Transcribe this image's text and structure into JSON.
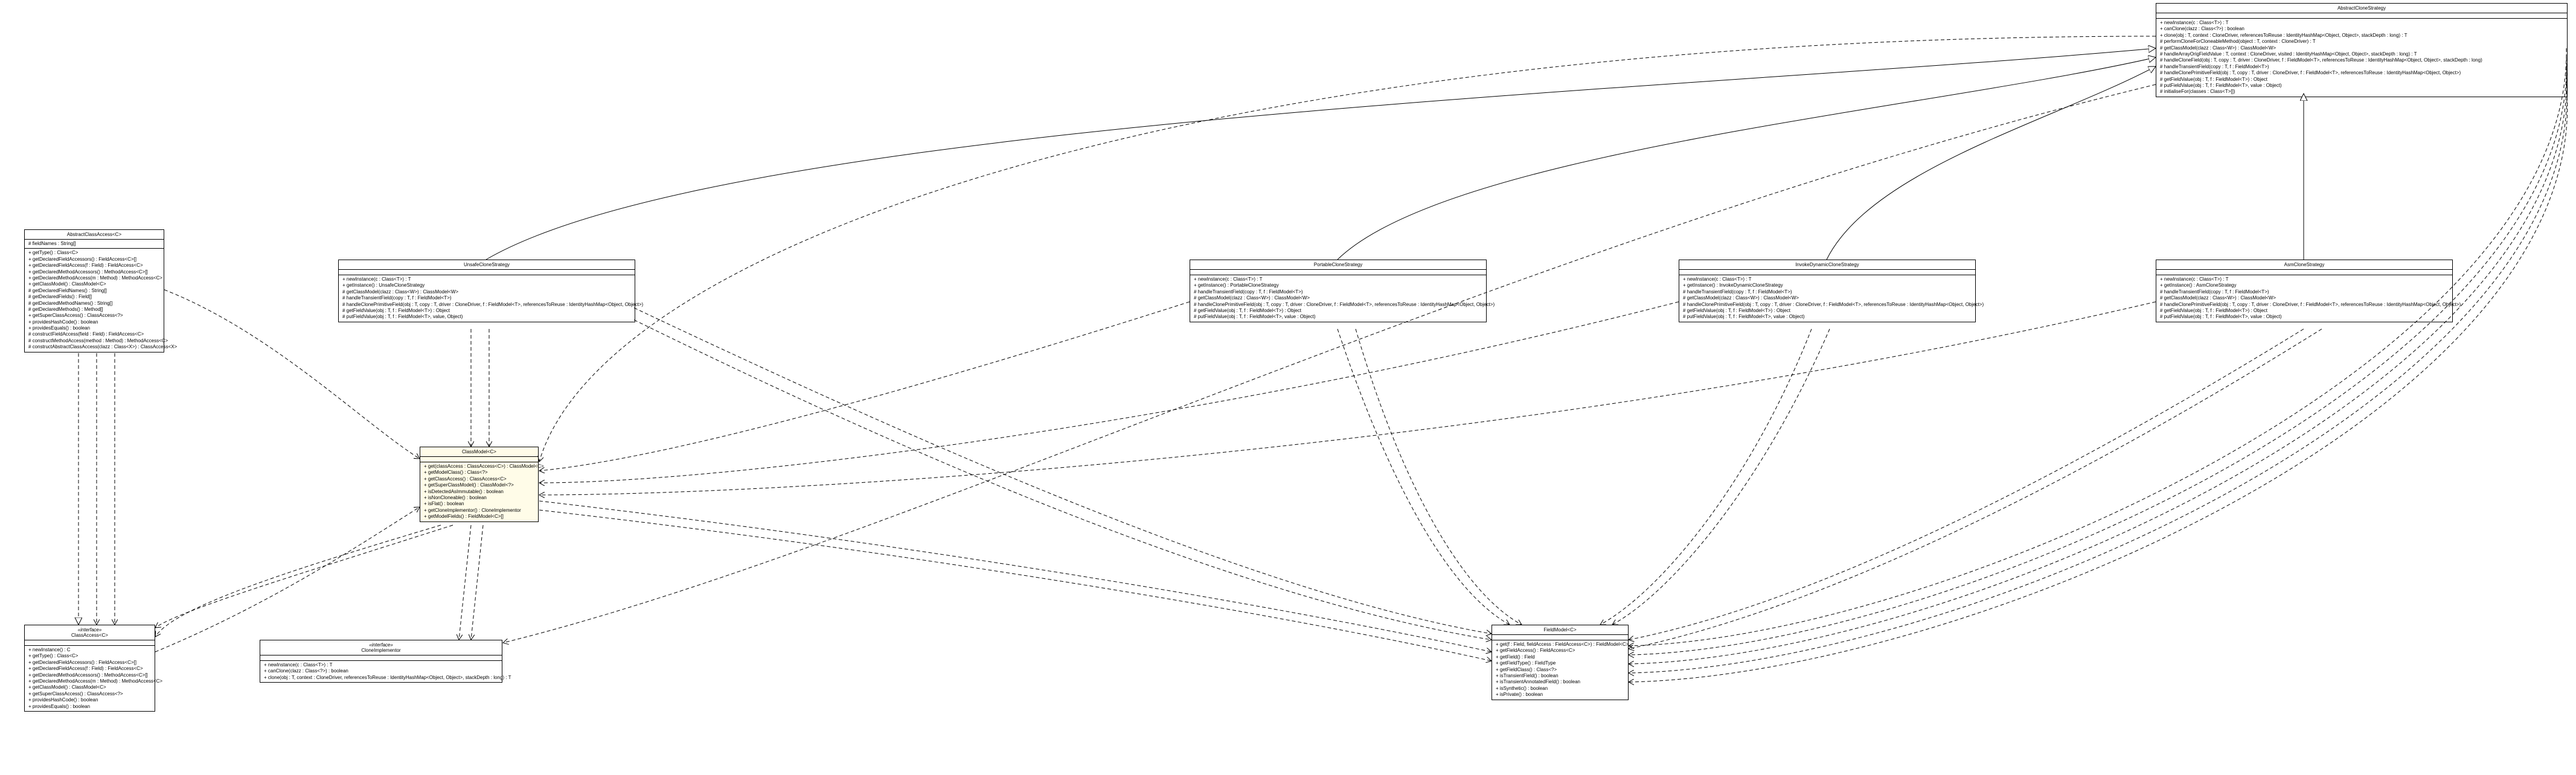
{
  "classes": {
    "abstractCloneStrategy": {
      "title": "AbstractCloneStrategy",
      "methods": [
        "+ newInstance(c : Class<T>) : T",
        "+ canClone(clazz : Class<?>) : boolean",
        "+ clone(obj : T, context : CloneDriver, referencesToReuse : IdentityHashMap<Object, Object>, stackDepth : long) : T",
        "# performCloneForCloneableMethod(object : T, context : CloneDriver) : T",
        "# getClassModel(clazz : Class<W>) : ClassModel<W>",
        "# handleArrayOrigFieldValue : T, context : CloneDriver, visited : IdentityHashMap<Object, Object>, stackDepth : long) : T",
        "# handleCloneField(obj : T, copy : T, driver : CloneDriver, f : FieldModel<T>, referencesToReuse : IdentityHashMap<Object, Object>, stackDepth : long)",
        "# handleTransientField(copy : T, f : FieldModel<T>)",
        "# handleClonePrimitiveField(obj : T, copy : T, driver : CloneDriver, f : FieldModel<T>, referencesToReuse : IdentityHashMap<Object, Object>)",
        "# getFieldValue(obj : T, f : FieldModel<T>) : Object",
        "# putFieldValue(obj : T, f : FieldModel<T>, value : Object)",
        "# initialiseFor(classes : Class<T>[])"
      ]
    },
    "abstractClassAccess": {
      "title": "AbstractClassAccess<C>",
      "fields": [
        "# fieldNames : String[]"
      ],
      "methods": [
        "+ getType() : Class<C>",
        "+ getDeclaredFieldAccessors() : FieldAccess<C>[]",
        "+ getDeclaredFieldAccess(f : Field) : FieldAccess<C>",
        "+ getDeclaredMethodAccessors() : MethodAccess<C>[]",
        "+ getDeclaredMethodAccess(m : Method) : MethodAccess<C>",
        "+ getClassModel() : ClassModel<C>",
        "# getDeclaredFieldNames() : String[]",
        "# getDeclaredFields() : Field[]",
        "# getDeclaredMethodNames() : String[]",
        "# getDeclaredMethods() : Method[]",
        "+ getSuperClassAccess() : ClassAccess<?>",
        "+ providesHashCode() : boolean",
        "+ providesEquals() : boolean",
        "# constructFieldAccess(field : Field) : FieldAccess<C>",
        "# constructMethodAccess(method : Method) : MethodAccess<C>",
        "# constructAbstractClassAccess(clazz : Class<X>) : ClassAccess<X>"
      ]
    },
    "unsafeCloneStrategy": {
      "title": "UnsafeCloneStrategy",
      "methods": [
        "+ newInstance(c : Class<T>) : T",
        "+ getInstance() : UnsafeCloneStrategy",
        "# getClassModel(clazz : Class<W>) : ClassModel<W>",
        "# handleTransientField(copy : T, f : FieldModel<T>)",
        "# handleClonePrimitiveField(obj : T, copy : T, driver : CloneDriver, f : FieldModel<T>, referencesToReuse : IdentityHashMap<Object, Object>)",
        "# getFieldValue(obj : T, f : FieldModel<T>) : Object",
        "# putFieldValue(obj : T, f : FieldModel<T>, value, Object)"
      ]
    },
    "portableCloneStrategy": {
      "title": "PortableCloneStrategy",
      "methods": [
        "+ newInstance(c : Class<T>) : T",
        "+ getInstance() : PortableCloneStrategy",
        "# handleTransientField(copy : T, f : FieldModel<T>)",
        "# getClassModel(clazz : Class<W>) : ClassModel<W>",
        "# handleClonePrimitiveField(obj : T, copy : T, driver : CloneDriver, f : FieldModel<T>, referencesToReuse : IdentityHashMap<Object, Object>)",
        "# getFieldValue(obj : T, f : FieldModel<T>) : Object",
        "# putFieldValue(obj : T, f : FieldModel<T>, value : Object)"
      ]
    },
    "invokeDynamicCloneStrategy": {
      "title": "InvokeDynamicCloneStrategy",
      "methods": [
        "+ newInstance(c : Class<T>) : T",
        "+ getInstance() : InvokeDynamicCloneStrategy",
        "# handleTransientField(copy : T, f : FieldModel<T>)",
        "# getClassModel(clazz : Class<W>) : ClassModel<W>",
        "# handleClonePrimitiveField(obj : T, copy : T, driver : CloneDriver, f : FieldModel<T>, referencesToReuse : IdentityHashMap<Object, Object>)",
        "# getFieldValue(obj : T, f : FieldModel<T>) : Object",
        "# putFieldValue(obj : T, f : FieldModel<T>, value : Object)"
      ]
    },
    "asmCloneStrategy": {
      "title": "AsmCloneStrategy",
      "methods": [
        "+ newInstance(c : Class<T>) : T",
        "+ getInstance() : AsmCloneStrategy",
        "# handleTransientField(copy : T, f : FieldModel<T>)",
        "# getClassModel(clazz : Class<W>) : ClassModel<W>",
        "# handleClonePrimitiveField(obj : T, copy : T, driver : CloneDriver, f : FieldModel<T>, referencesToReuse : IdentityHashMap<Object, Object>)",
        "# getFieldValue(obj : T, f : FieldModel<T>) : Object",
        "# putFieldValue(obj : T, f : FieldModel<T>, value : Object)"
      ]
    },
    "classModel": {
      "title": "ClassModel<C>",
      "methods": [
        "+ get(classAccess : ClassAccess<C>) : ClassModel<C>",
        "+ getModelClass() : Class<?>",
        "+ getClassAccess() : ClassAccess<C>",
        "+ getSuperClassModel() : ClassModel<?>",
        "+ isDetectedAsImmutable() : boolean",
        "+ isNonCloneable() : boolean",
        "+ isFlat() : boolean",
        "+ getCloneImplementor() : CloneImplementor",
        "+ getModelFields() : FieldModel<C>[]"
      ]
    },
    "classAccess": {
      "stereotype": "«interface»",
      "title": "ClassAccess<C>",
      "methods": [
        "+ newInstance() : C",
        "+ getType() : Class<C>",
        "+ getDeclaredFieldAccessors() : FieldAccess<C>[]",
        "+ getDeclaredFieldAccess(f : Field) : FieldAccess<C>",
        "+ getDeclaredMethodAccessors() : MethodAccess<C>[]",
        "+ getDeclaredMethodAccess(m : Method) : MethodAccess<C>",
        "+ getClassModel() : ClassModel<C>",
        "+ getSuperClassAccess() : ClassAccess<?>",
        "+ providesHashCode() : boolean",
        "+ providesEquals() : boolean"
      ]
    },
    "cloneImplementor": {
      "stereotype": "«interface»",
      "title": "CloneImplementor",
      "methods": [
        "+ newInstance(c : Class<T>) : T",
        "+ canClone(clazz : Class<?>) : boolean",
        "+ clone(obj : T, context : CloneDriver, referencesToReuse : IdentityHashMap<Object, Object>, stackDepth : long) : T"
      ]
    },
    "fieldModel": {
      "title": "FieldModel<C>",
      "methods": [
        "+ get(f : Field, fieldAccess : FieldAccess<C>) : FieldModel<C>",
        "+ getFieldAccess() : FieldAccess<C>",
        "+ getField() : Field",
        "+ getFieldType() : FieldType",
        "+ getFieldClass() : Class<?>",
        "+ isTransientField() : boolean",
        "+ isTransientAnnotatedField() : boolean",
        "+ isSynthetic() : boolean",
        "+ isPrivate() : boolean"
      ]
    }
  }
}
